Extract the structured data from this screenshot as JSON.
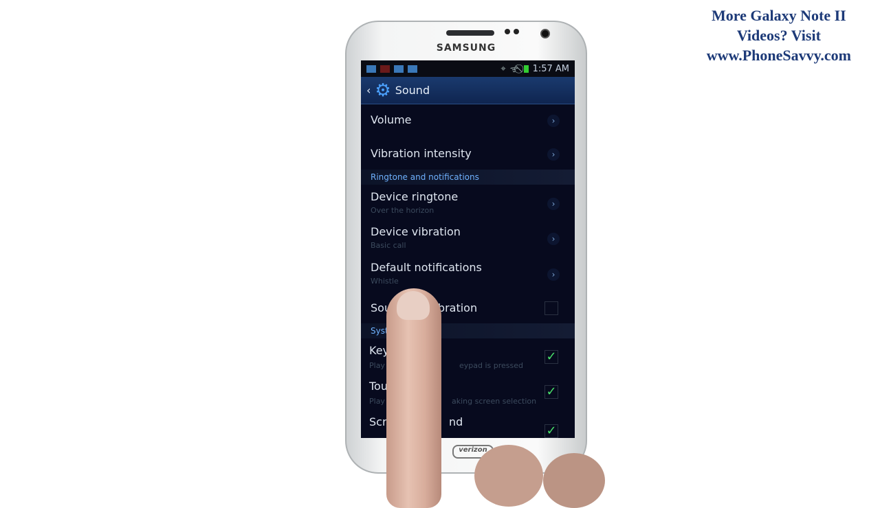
{
  "watermark": {
    "line1": "More Galaxy Note II",
    "line2": "Videos? Visit",
    "line3": "www.PhoneSavvy.com"
  },
  "phone": {
    "brand": "SAMSUNG",
    "carrier": "verizon"
  },
  "status_bar": {
    "time": "1:57 AM",
    "icons": [
      "gmail-icon",
      "missed-call-icon",
      "video-icon",
      "video-icon",
      "gps-icon",
      "wifi-icon",
      "no-signal-icon",
      "battery-icon"
    ]
  },
  "action_bar": {
    "title": "Sound"
  },
  "items": [
    {
      "title": "Volume"
    },
    {
      "title": "Vibration intensity"
    },
    {
      "header": "Ringtone and notifications"
    },
    {
      "title": "Device ringtone",
      "subtitle": "Over the horizon"
    },
    {
      "title": "Device vibration",
      "subtitle": "Basic call"
    },
    {
      "title": "Default notifications",
      "subtitle": "Whistle"
    },
    {
      "title_left": "Sou",
      "title_right": "vibration",
      "checked": false
    },
    {
      "header": "Syst"
    },
    {
      "title": "Key",
      "subtitle_left": "Play",
      "subtitle_right": "eypad is pressed",
      "checked": true
    },
    {
      "title": "Tou",
      "subtitle_left": "Play",
      "subtitle_right": "aking screen selection",
      "checked": true
    },
    {
      "title_left": "Scr",
      "title_right": "nd",
      "checked": true
    }
  ],
  "colors": {
    "accent": "#4ca2ff",
    "check": "#49e06a",
    "background": "#070a1e"
  }
}
